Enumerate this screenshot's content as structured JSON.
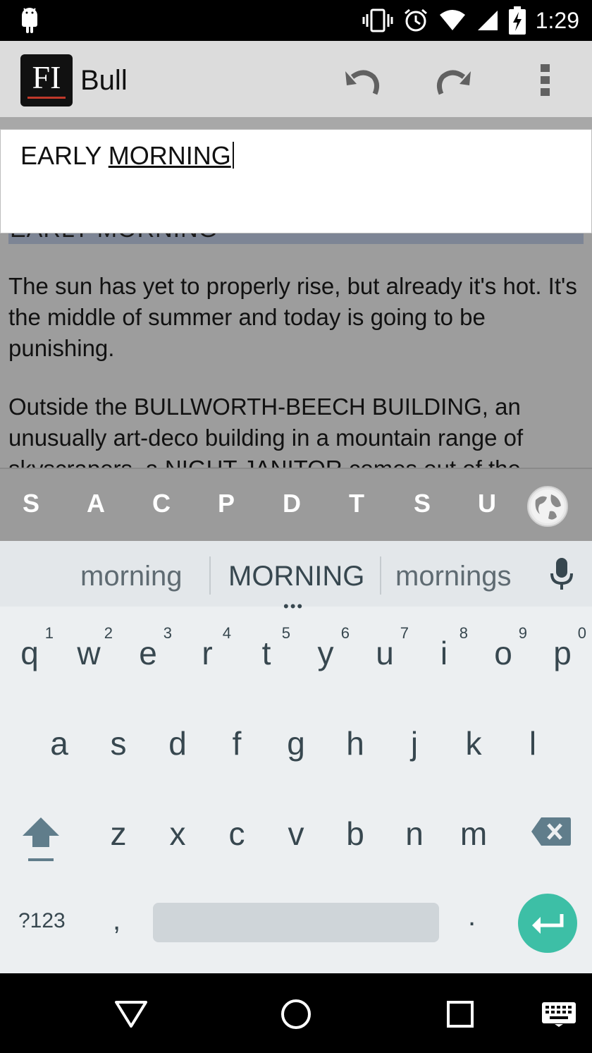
{
  "status_bar": {
    "time": "1:29"
  },
  "app_bar": {
    "logo_text": "FI",
    "title": "Bull"
  },
  "edit_box": {
    "word1": "EARLY",
    "word2": "MORNING"
  },
  "document": {
    "heading_ghost": "EARLY MORNING",
    "paragraphs": [
      "The sun has yet to properly rise, but already it's hot.  It's the middle of summer and today is going to be punishing.",
      "Outside the BULLWORTH-BEECH BUILDING, an unusually art-deco building in a mountain range of skyscrapers, a NIGHT JANITOR comes out of the"
    ]
  },
  "scene_bar": {
    "keys": [
      "S",
      "A",
      "C",
      "P",
      "D",
      "T",
      "S",
      "U"
    ]
  },
  "keyboard": {
    "suggestions": [
      "morning",
      "MORNING",
      "mornings"
    ],
    "row1": [
      {
        "ch": "q",
        "hint": "1"
      },
      {
        "ch": "w",
        "hint": "2"
      },
      {
        "ch": "e",
        "hint": "3"
      },
      {
        "ch": "r",
        "hint": "4"
      },
      {
        "ch": "t",
        "hint": "5"
      },
      {
        "ch": "y",
        "hint": "6"
      },
      {
        "ch": "u",
        "hint": "7"
      },
      {
        "ch": "i",
        "hint": "8"
      },
      {
        "ch": "o",
        "hint": "9"
      },
      {
        "ch": "p",
        "hint": "0"
      }
    ],
    "row2": [
      "a",
      "s",
      "d",
      "f",
      "g",
      "h",
      "j",
      "k",
      "l"
    ],
    "row3": [
      "z",
      "x",
      "c",
      "v",
      "b",
      "n",
      "m"
    ],
    "symbols_label": "?123",
    "comma": ",",
    "period": "."
  },
  "colors": {
    "accent_enter": "#3dbfa6",
    "keyboard_bg": "#eceff1",
    "dim_overlay": "#9d9d9d"
  }
}
